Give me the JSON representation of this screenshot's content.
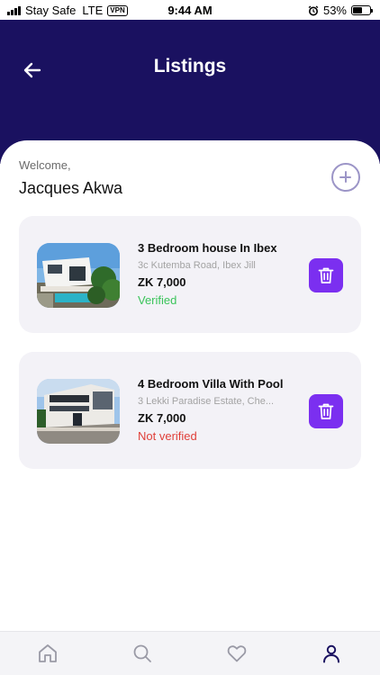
{
  "status_bar": {
    "carrier": "Stay Safe",
    "network": "LTE",
    "vpn": "VPN",
    "time": "9:44 AM",
    "battery": "53%",
    "battery_level": 0.53
  },
  "header": {
    "title": "Listings",
    "back_icon": "arrow-left-icon",
    "background": "#1a1160"
  },
  "welcome": {
    "greeting": "Welcome,",
    "user_name": "Jacques Akwa",
    "add_icon": "plus-circle-icon"
  },
  "listings": [
    {
      "title": "3 Bedroom house In Ibex",
      "address": "3c Kutemba Road, Ibex Jill",
      "price": "ZK 7,000",
      "status": "Verified",
      "status_color": "#3ac45a",
      "delete_icon": "trash-icon"
    },
    {
      "title": "4 Bedroom Villa With Pool",
      "address": "3 Lekki Paradise Estate, Che...",
      "price": "ZK 7,000",
      "status": "Not verified",
      "status_color": "#e0403a",
      "delete_icon": "trash-icon"
    }
  ],
  "colors": {
    "accent": "#7b2ff0",
    "nav_active": "#1a1160",
    "nav_inactive": "#9a9aa6"
  },
  "bottom_nav": [
    {
      "icon": "home-icon",
      "active": false
    },
    {
      "icon": "search-icon",
      "active": false
    },
    {
      "icon": "heart-icon",
      "active": false
    },
    {
      "icon": "profile-icon",
      "active": true
    }
  ]
}
